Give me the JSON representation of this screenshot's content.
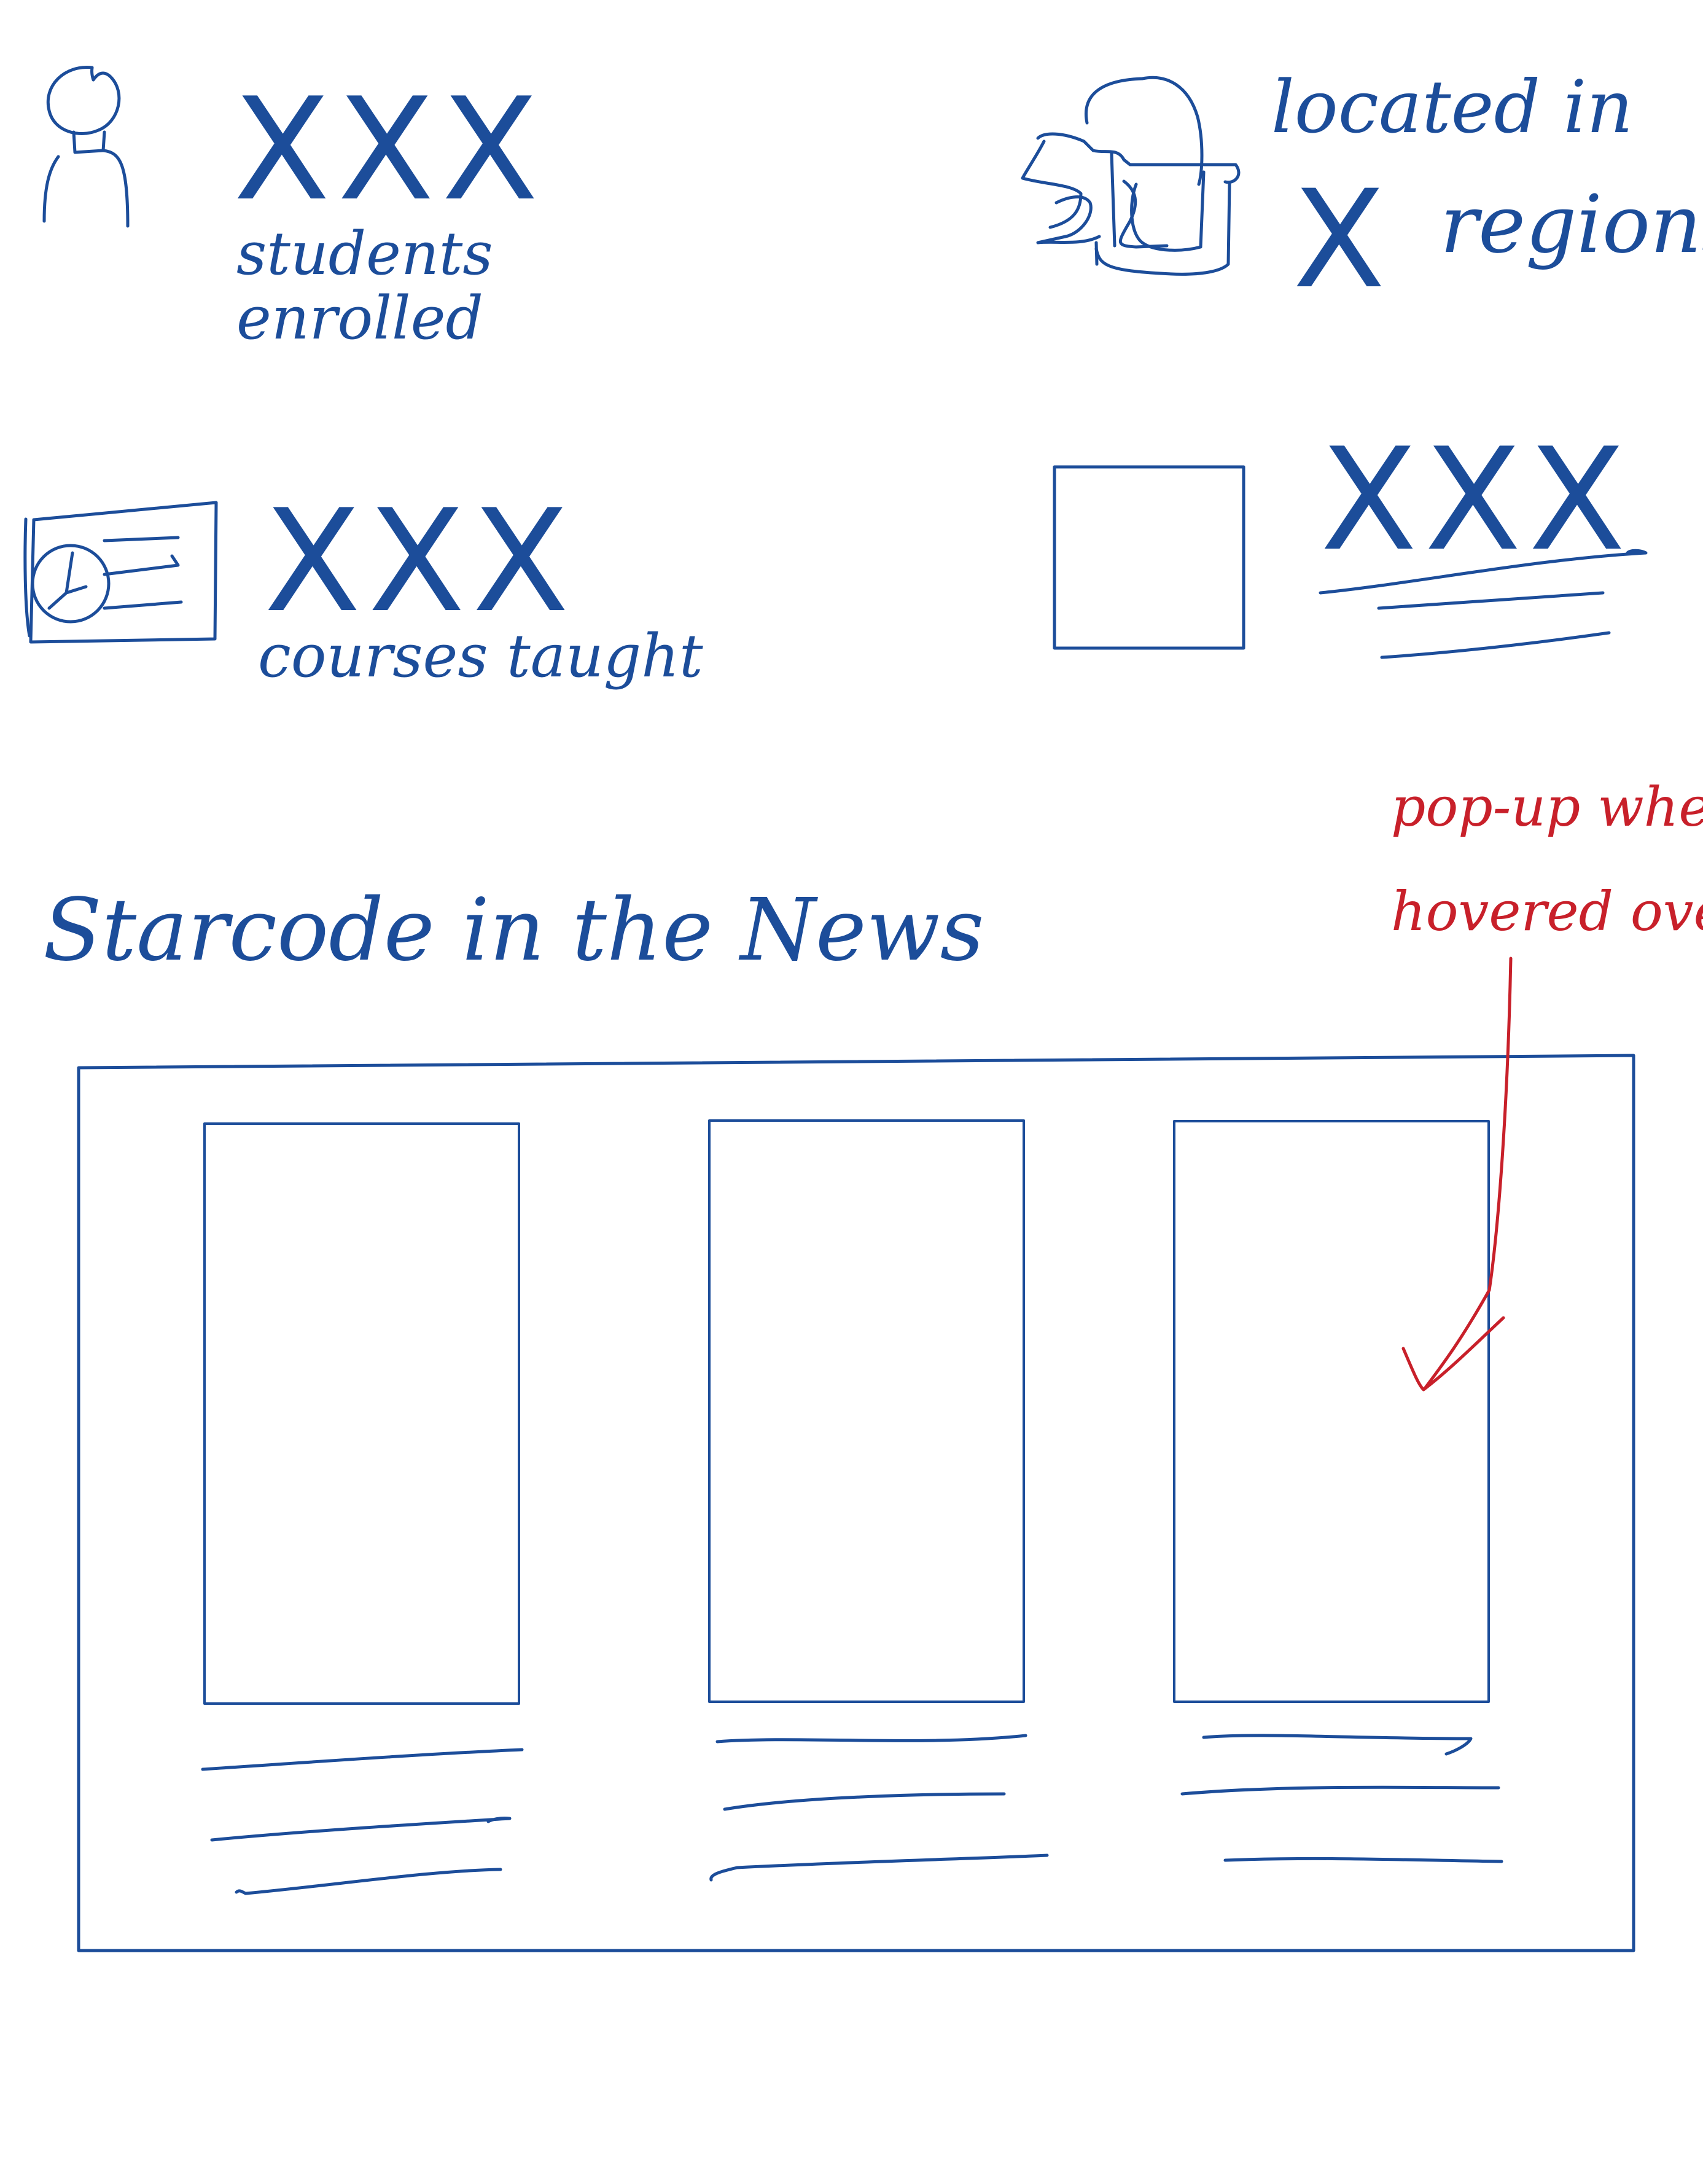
{
  "stats": {
    "students": {
      "value": "XXX",
      "label_line1": "students",
      "label_line2": "enrolled",
      "icon": "person-icon"
    },
    "courses": {
      "value": "XXX",
      "label": "courses taught",
      "icon": "course-card-icon"
    },
    "regions": {
      "label_line1": "located in",
      "value": "X",
      "label_line2": "regions",
      "icon": "map-icon"
    },
    "extra": {
      "value": "XXX",
      "icon": "image-placeholder-icon"
    }
  },
  "news": {
    "title": "Starcode in the News",
    "cards": [
      {
        "icon": "news-image-placeholder"
      },
      {
        "icon": "news-image-placeholder"
      },
      {
        "icon": "news-image-placeholder"
      }
    ]
  },
  "annotation": {
    "line1": "pop-up when",
    "line2": "hovered over"
  },
  "colors": {
    "ink": "#1c4d9a",
    "annotation": "#c8202a",
    "background": "#ffffff"
  }
}
